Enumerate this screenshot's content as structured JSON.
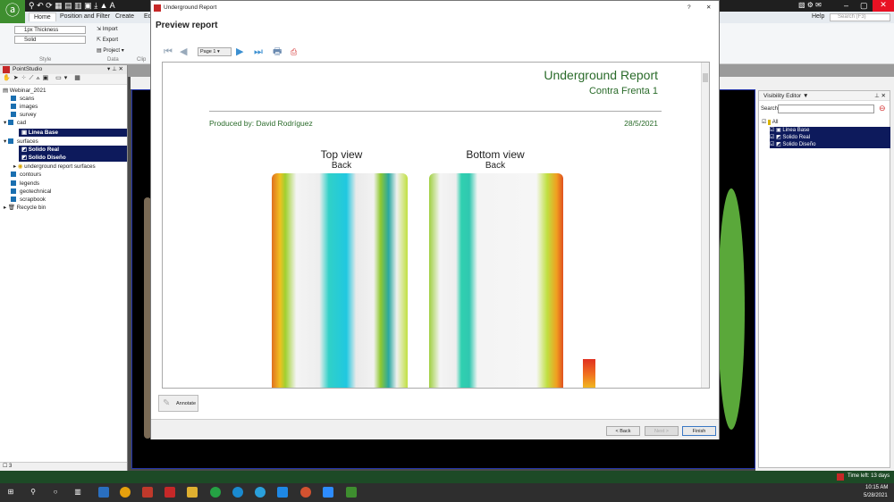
{
  "app": {
    "ribbon_tabs": [
      "Home",
      "Position and Filter",
      "Create",
      "Ed"
    ],
    "style_group": {
      "thickness": "1px Thickness",
      "line": "Solid",
      "label": "Style"
    },
    "data_group": {
      "import": "Import",
      "export": "Export",
      "project": "Project",
      "label": "Data"
    },
    "clip_label": "Clip",
    "help": "Help",
    "search_placeholder": "Search (F3)"
  },
  "left_panel": {
    "title": "PointStudio",
    "tree": [
      {
        "label": "Webinar_2021"
      },
      {
        "label": "scans"
      },
      {
        "label": "images"
      },
      {
        "label": "survey"
      },
      {
        "label": "cad"
      },
      {
        "label": "Linea Base",
        "selected": true
      },
      {
        "label": "surfaces"
      },
      {
        "label": "Solido Real",
        "selected": true
      },
      {
        "label": "Solido Diseño",
        "selected": true
      },
      {
        "label": "underground report surfaces"
      },
      {
        "label": "contours"
      },
      {
        "label": "legends"
      },
      {
        "label": "geotechnical"
      },
      {
        "label": "scrapbook"
      },
      {
        "label": "Recycle bin"
      }
    ],
    "footer_count": "3"
  },
  "visibility_editor": {
    "title": "Visibility Editor",
    "search_label": "Search",
    "search_value": "",
    "items": [
      {
        "label": "All",
        "checked": true
      },
      {
        "label": "Linea Base",
        "checked": true
      },
      {
        "label": "Solido Real",
        "checked": true
      },
      {
        "label": "Solido Diseño",
        "checked": true
      }
    ]
  },
  "dialog": {
    "title": "Underground Report",
    "help": "?",
    "close": "✕",
    "heading": "Preview report",
    "page_select": "Page 1",
    "report": {
      "title": "Underground Report",
      "subtitle": "Contra Frenta 1",
      "produced_by": "Produced by: David Rodríguez",
      "date": "28/5/2021",
      "views": [
        {
          "title": "Top view",
          "side": "Back"
        },
        {
          "title": "Bottom view",
          "side": "Back"
        }
      ]
    },
    "annotate": "Annotate",
    "back": "< Back",
    "next": "Next >",
    "finish": "Finish"
  },
  "status_bar": {
    "trial": "Time left: 13 days"
  },
  "taskbar": {
    "time": "10:15 AM",
    "date": "5/28/2021"
  },
  "colors": {
    "brand_green": "#3e8e2f",
    "report_green": "#2a6b2a",
    "selection": "#0d1a5c",
    "status_bar": "#1d4a26"
  }
}
